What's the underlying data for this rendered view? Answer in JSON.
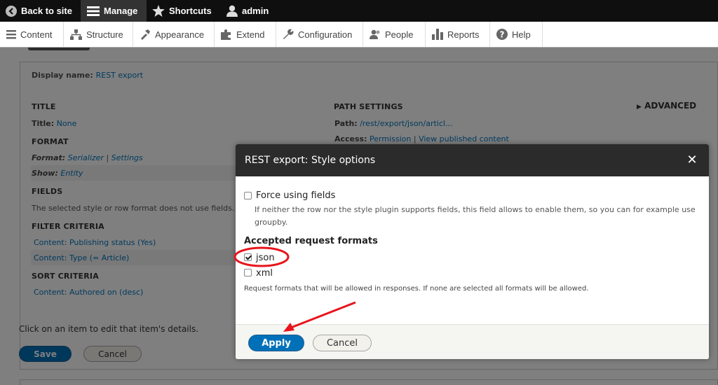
{
  "toolbar": {
    "back_label": "Back to site",
    "manage_label": "Manage",
    "shortcuts_label": "Shortcuts",
    "user_label": "admin"
  },
  "tray": {
    "items": [
      {
        "label": "Content",
        "icon": "content-icon"
      },
      {
        "label": "Structure",
        "icon": "structure-icon"
      },
      {
        "label": "Appearance",
        "icon": "appearance-icon"
      },
      {
        "label": "Extend",
        "icon": "extend-icon"
      },
      {
        "label": "Configuration",
        "icon": "wrench-icon"
      },
      {
        "label": "People",
        "icon": "people-icon"
      },
      {
        "label": "Reports",
        "icon": "reports-icon"
      },
      {
        "label": "Help",
        "icon": "help-icon"
      }
    ]
  },
  "view": {
    "display_name_label": "Display name:",
    "display_name_value": "REST export",
    "title_heading": "TITLE",
    "title_label": "Title:",
    "title_value": "None",
    "format_heading": "FORMAT",
    "format_label": "Format:",
    "format_value": "Serializer",
    "format_sep": "|",
    "format_settings": "Settings",
    "show_label": "Show:",
    "show_value": "Entity",
    "fields_heading": "FIELDS",
    "fields_text": "The selected style or row format does not use fields.",
    "filter_heading": "FILTER CRITERIA",
    "filter_items": [
      "Content: Publishing status (Yes)",
      "Content: Type (= Article)"
    ],
    "sort_heading": "SORT CRITERIA",
    "sort_items": [
      "Content: Authored on (desc)"
    ],
    "path_heading": "PATH SETTINGS",
    "path_label": "Path:",
    "path_value": "/rest/export/json/articl...",
    "access_label": "Access:",
    "access_value": "Permission",
    "access_sep": "|",
    "access_perm": "View published content",
    "advanced_label": "ADVANCED",
    "help_text": "Click on an item to edit that item's details.",
    "save_label": "Save",
    "cancel_label": "Cancel"
  },
  "dialog": {
    "title": "REST export: Style options",
    "close_label": "✕",
    "force_fields_label": "Force using fields",
    "force_fields_checked": false,
    "force_fields_desc": "If neither the row nor the style plugin supports fields, this field allows to enable them, so you can for example use groupby.",
    "formats_heading": "Accepted request formats",
    "formats": [
      {
        "label": "json",
        "checked": true
      },
      {
        "label": "xml",
        "checked": false
      }
    ],
    "formats_desc": "Request formats that will be allowed in responses. If none are selected all formats will be allowed.",
    "apply_label": "Apply",
    "cancel_label": "Cancel"
  },
  "colors": {
    "accent": "#0071b8",
    "link": "#0074bd",
    "annotation": "#e8141c"
  }
}
